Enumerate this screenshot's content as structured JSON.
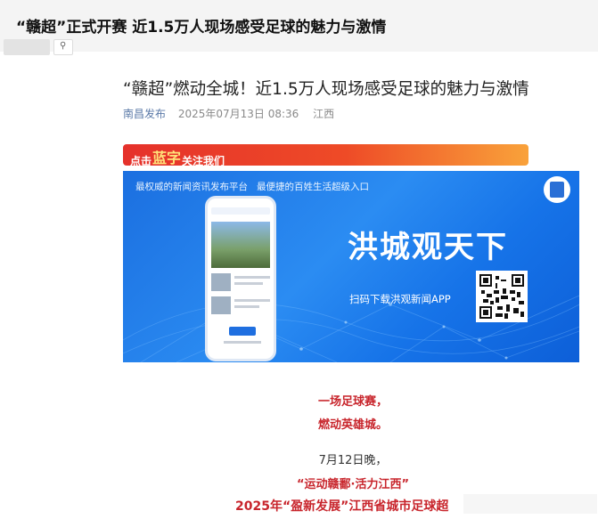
{
  "header": {
    "title": "“赣超”正式开赛  近1.5万人现场感受足球的魅力与激情"
  },
  "article": {
    "title": "“赣超”燃动全城！近1.5万人现场感受足球的魅力与激情",
    "source": "南昌发布",
    "datetime": "2025年07月13日 08:36",
    "region": "江西"
  },
  "follow_bar": {
    "prefix": "点击",
    "highlight": "蓝字",
    "suffix": "关注我们"
  },
  "banner": {
    "tagline_left": "最权威的新闻资讯发布平台",
    "tagline_right": "最便捷的百姓生活超级入口",
    "headline": "洪城观天下",
    "download_text": "扫码下载洪观新闻APP"
  },
  "body": {
    "line1": "一场足球赛，",
    "line2": "燃动英雄城。",
    "line3": "7月12日晚，",
    "line4": "“运动赣鄱·活力江西”",
    "line5": "2025年“盈新发展”江西省城市足球超"
  },
  "colors": {
    "accent_red": "#c8252c",
    "banner_blue": "#1f7ae8",
    "source_blue": "#5b7aa8"
  }
}
